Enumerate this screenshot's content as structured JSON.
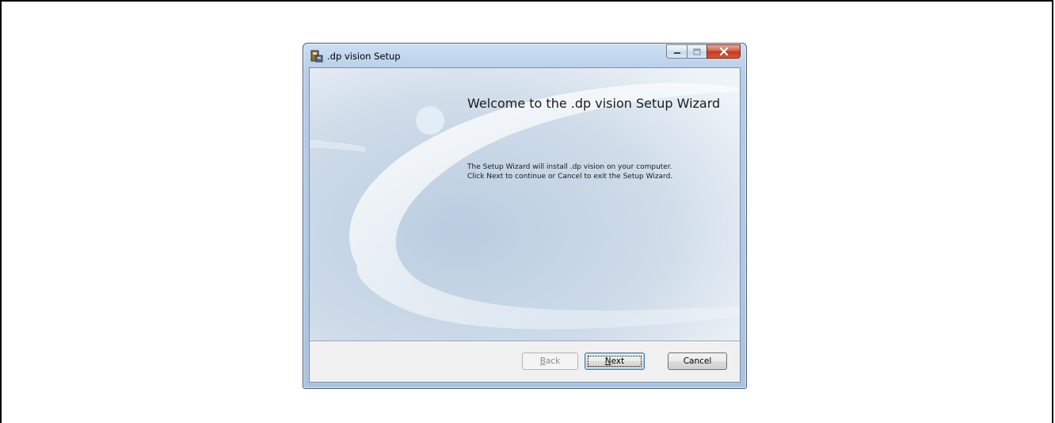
{
  "window": {
    "title": ".dp vision Setup",
    "app_icon": "installer-icon",
    "caption_buttons": {
      "minimize_icon": "minimize-icon",
      "maximize_icon": "maximize-icon",
      "close_icon": "close-icon"
    }
  },
  "wizard": {
    "heading": "Welcome to the .dp vision Setup Wizard",
    "body_lines": [
      "The Setup Wizard will install .dp vision on your computer.",
      "Click Next to continue or Cancel to exit the Setup Wizard."
    ]
  },
  "buttons": {
    "back": {
      "label_pre": "",
      "label_key": "B",
      "label_post": "ack",
      "enabled": false
    },
    "next": {
      "label_pre": "",
      "label_key": "N",
      "label_post": "ext",
      "enabled": true,
      "focused": true
    },
    "cancel": {
      "label": "Cancel",
      "enabled": true
    }
  },
  "colors": {
    "close_button": "#c4391f",
    "focus_border": "#3c7fb1",
    "banner_base": "#c9d9e7"
  }
}
